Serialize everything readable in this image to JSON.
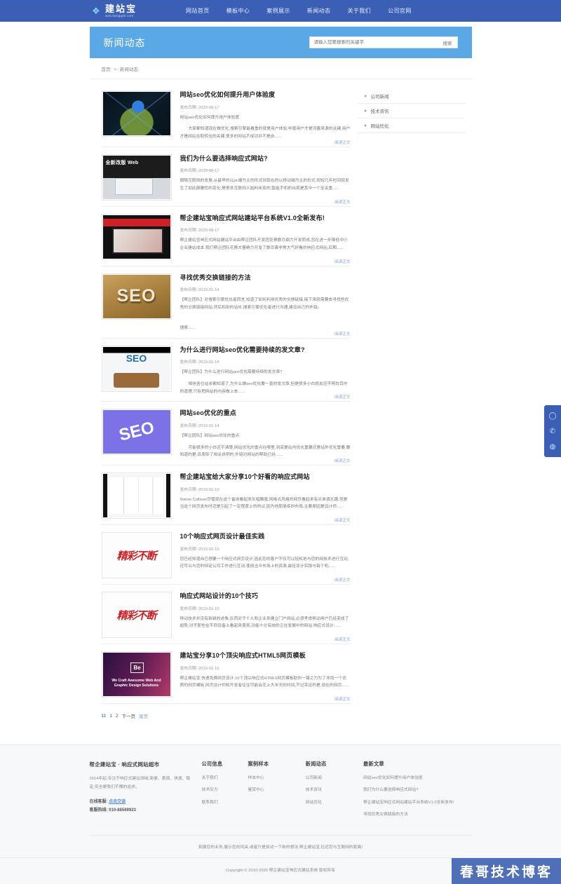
{
  "site": {
    "logo_main": "建站宝",
    "logo_sub": "web.bangqibl.com",
    "logo_icon": "feather-logo-icon"
  },
  "nav": {
    "items": [
      {
        "label": "网站首页"
      },
      {
        "label": "模板中心"
      },
      {
        "label": "案例展示"
      },
      {
        "label": "新闻动态"
      },
      {
        "label": "关于我们"
      },
      {
        "label": "公司官网"
      }
    ]
  },
  "banner": {
    "title": "新闻动态",
    "search_placeholder": "请输入您要搜索的关键字",
    "search_value": "",
    "search_button": "搜索",
    "bg_color": "#5aa9e6"
  },
  "breadcrumb": {
    "home": "首页",
    "separator": ">",
    "current": "新闻动态"
  },
  "articles": [
    {
      "title": "网站seo优化如何提升用户体验度",
      "date_label": "发布日期:",
      "date": "2020-08-17",
      "lead": "网站seo优化如何提升用户体验度",
      "desc": "大家都知道现在做优化,搜索引擎最看重的就是用户体验,毕竟用户才是流量来源的关键,用户才是网站在取转化的关键,很多的网站不成功并不是自......",
      "read_more": "阅读正文",
      "thumb": "globe-on-hand-thumb"
    },
    {
      "title": "我们为什么要选择响应式网站?",
      "date_label": "发布日期:",
      "date": "2020-08-17",
      "lead": "",
      "desc": "顺随互联网的发展,从最早的以pc端为主的形式到现在的以移动端为主的形式,短短几年时间就发生了如此颠覆性的变化,是很多互联网人始料未及的,智能手机的出现是其中一个至关重......",
      "read_more": "阅读正文",
      "thumb": "web-redesign-thumb"
    },
    {
      "title": "帮企建站宝响应式网站建站平台系统V1.0全新发布!",
      "date_label": "发布日期:",
      "date": "2020-08-17",
      "lead": "",
      "desc": "帮企建站宝响应式网站建站平台由帮企团队开发团花费数月鼎力开发而成,旨在进一步降低中小企业建站成本,我们帮企团队花费大量精力开发了数百套非常大气好看的响应式网站,后期......",
      "read_more": "阅读正文",
      "thumb": "website-build-system-thumb"
    },
    {
      "title": "寻找优秀交换链接的方法",
      "date_label": "发布日期:",
      "date": "2019-01-14",
      "lead": "",
      "desc": "【帮企团队】对搜索引擎优化者而言,知道了如何利用优秀的交换链接,接下来就需要去寻找些优秀的交换链接网站,然后和别的站长,搜索引擎优化者进行沟通,建设自己的外链。",
      "desc2": "搜索......",
      "read_more": "阅读正文",
      "thumb": "seo-wood-blocks-thumb"
    },
    {
      "title": "为什么进行网站seo优化需要持续的发文章?",
      "date_label": "发布日期:",
      "date": "2019-01-14",
      "lead": "【帮企团队】为什么进行网站seo优化需要持续的发文章?",
      "desc": "相信各位站长都知道了,为什么做seo优化要一直的发文章,但是很多小白朋友还不明白其中的道理,只有把网站的内容做上去......",
      "read_more": "阅读正文",
      "thumb": "seo-meeting-thumb"
    },
    {
      "title": "网站seo优化的重点",
      "date_label": "发布日期:",
      "date": "2019-01-14",
      "lead": "【帮企团队】网站seo优化的重点",
      "desc": "可能很多的小白还不清楚,网站优化的重点在哪里,到底是站内优化重要还是站外优化重要,要知道的是,百度除了相关说明的,外链对网站的帮助已经......",
      "read_more": "阅读正文",
      "thumb": "seo-purple-tag-thumb"
    },
    {
      "title": "帮企建站宝给大家分享10个好看的响应式网站",
      "date_label": "发布日期:",
      "date": "2019-01-10",
      "lead": "",
      "desc": "Simon Collison尽管现在这个备用看起来灰暗朦胧,网格式风格的网页看起来有点单调无趣,但是当这个网页发布时还是引起了一定程度上的热议,因为他那简练的布局,主要原因是设计师......",
      "read_more": "阅读正文",
      "thumb": "grid-layout-thumb"
    },
    {
      "title": "10个响应式网页设计最佳实践",
      "date_label": "发布日期:",
      "date": "2019-01-10",
      "lead": "",
      "desc": "您已经知道自己想要一个响应式网页设计,因此您的客户不仅可以轻松地与您的网技术进行互动,还可以与您的特定公司工作进行互动,使用当今市场上的资源,最佳设计实践与每个机......",
      "read_more": "阅读正文",
      "thumb": "calligraphy-red-thumb"
    },
    {
      "title": "响应式网站设计的10个技巧",
      "date_label": "发布日期:",
      "date": "2019-01-10",
      "lead": "",
      "desc": "移动技术并没有新颖的迹象,反而对于个人和企业来建立门户网站,必须考虑移动用户已经变成了趋势,对于那些在不同设备上看起来美观,功能十分有效的正在发展中的网站,响应式设计......",
      "read_more": "阅读正文",
      "thumb": "calligraphy-red-thumb"
    },
    {
      "title": "建站宝分享10个顶尖响应式HTML5网页模板",
      "date_label": "发布日期:",
      "date": "2019-01-10",
      "lead": "",
      "desc": "帮企建站宝:快速免费网页设计,10个顶尖响应式HTML5网页模板助你一臂之力为了寻找一个优质的网页模板,网页设计师和开发者往往可能会花上大半天的时间,不过幸运的是,现在的网页......",
      "read_more": "阅读正文",
      "thumb": "behance-design-thumb"
    }
  ],
  "pagination": {
    "count": "11",
    "pages": [
      "1",
      "2"
    ],
    "current_index": 0,
    "next": "下一页",
    "last": "尾页"
  },
  "sidebar": {
    "items": [
      {
        "label": "公司新闻"
      },
      {
        "label": "技术资讯"
      },
      {
        "label": "网站优化"
      }
    ]
  },
  "footer": {
    "brand": {
      "title": "帮企建站宝 · 响应式网站超市",
      "desc": "2014年起,专注于响应式建站领域,简便、美观、快速、稳定,安全是我们不懈的追求。",
      "service_label": "在线客服:",
      "service_link": "点击交谈",
      "hotline_label": "客服热线:",
      "hotline": "010-88569923"
    },
    "columns": [
      {
        "title": "公司信息",
        "links": [
          {
            "label": "关于我们"
          },
          {
            "label": "技术实力"
          },
          {
            "label": "联系我们"
          }
        ]
      },
      {
        "title": "案例样本",
        "links": [
          {
            "label": "样本中心"
          },
          {
            "label": "鉴赏中心"
          }
        ]
      },
      {
        "title": "新闻动态",
        "links": [
          {
            "label": "公司新闻"
          },
          {
            "label": "技术资讯"
          },
          {
            "label": "网站优化"
          }
        ]
      }
    ],
    "latest": {
      "title": "最新文章",
      "links": [
        {
          "label": "网站seo优化如何提升用户体验度"
        },
        {
          "label": "我们为什么要选择响应式网站?"
        },
        {
          "label": "帮企建站宝响应式网站建站平台系统V1.0全新发布!"
        },
        {
          "label": "寻找优秀交换链接的方法"
        }
      ]
    },
    "note": "拓展您的业务,展示您的风采,或者只是尝试一下新的想法,帮企建站宝,拉近您与互联网的距离!",
    "copyright": "Copyright © 2010-2020 帮企建站宝响应式建站系统 版权所有"
  },
  "float_bar": {
    "buttons": [
      {
        "icon": "qq-icon",
        "glyph": "◯"
      },
      {
        "icon": "phone-icon",
        "glyph": "✆"
      },
      {
        "icon": "wechat-icon",
        "glyph": "◍"
      }
    ]
  },
  "watermark": {
    "text": "春哥技术博客"
  }
}
